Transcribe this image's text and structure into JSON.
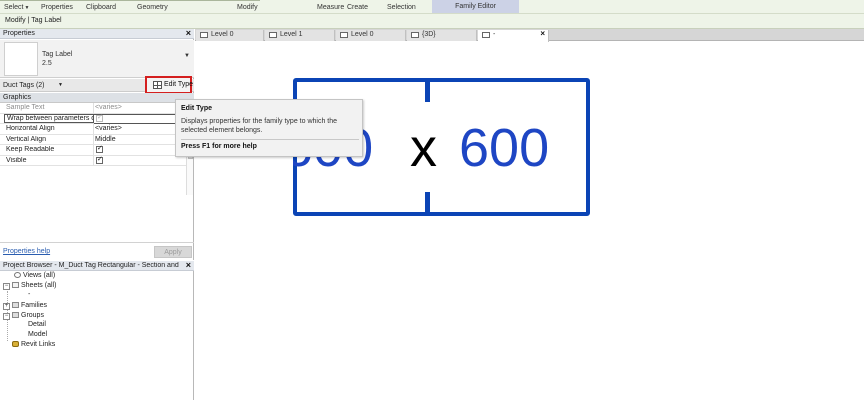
{
  "ribbon": {
    "select": "Select",
    "properties": "Properties",
    "clipboard": "Clipboard",
    "geometry": "Geometry",
    "modify": "Modify",
    "measure": "Measure",
    "create": "Create",
    "selection": "Selection",
    "family_editor": "Family Editor"
  },
  "context_bar": {
    "label": "Modify | Tag Label"
  },
  "properties_panel": {
    "title": "Properties",
    "type_name": "Tag Label",
    "type_size": "2.5",
    "selector": "Duct Tags (2)",
    "edit_type_label": "Edit Type",
    "group": "Graphics",
    "rows": [
      {
        "name": "Sample Text",
        "value": "<varies>"
      },
      {
        "name": "Wrap between parameters o...",
        "value": ""
      },
      {
        "name": "Horizontal Align",
        "value": "<varies>"
      },
      {
        "name": "Vertical Align",
        "value": "Middle"
      },
      {
        "name": "Keep Readable",
        "value": ""
      },
      {
        "name": "Visible",
        "value": ""
      }
    ],
    "help_link": "Properties help",
    "apply_label": "Apply"
  },
  "project_browser": {
    "title": "Project Browser - M_Duct Tag Rectangular - Section and Ele...",
    "items": [
      {
        "label": "Views (all)"
      },
      {
        "label": "Sheets (all)"
      },
      {
        "label": "-"
      },
      {
        "label": "Families"
      },
      {
        "label": "Groups"
      },
      {
        "label": "Detail"
      },
      {
        "label": "Model"
      },
      {
        "label": "Revit Links"
      }
    ]
  },
  "view_tabs": [
    {
      "label": "Level 0"
    },
    {
      "label": "Level 1"
    },
    {
      "label": "Level 0"
    },
    {
      "label": "{3D}"
    },
    {
      "label": "-"
    }
  ],
  "canvas": {
    "tag_width": "600",
    "tag_separator": "x",
    "tag_height": "600"
  },
  "tooltip": {
    "title": "Edit Type",
    "description": "Displays properties for the family type to which the selected element belongs.",
    "help": "Press F1 for more help"
  },
  "colors": {
    "tag_blue": "#0b44b5",
    "highlight_red": "#d41f1f",
    "ribbon_bg": "#eef4e8",
    "family_editor_tab": "#ccd2e6"
  }
}
